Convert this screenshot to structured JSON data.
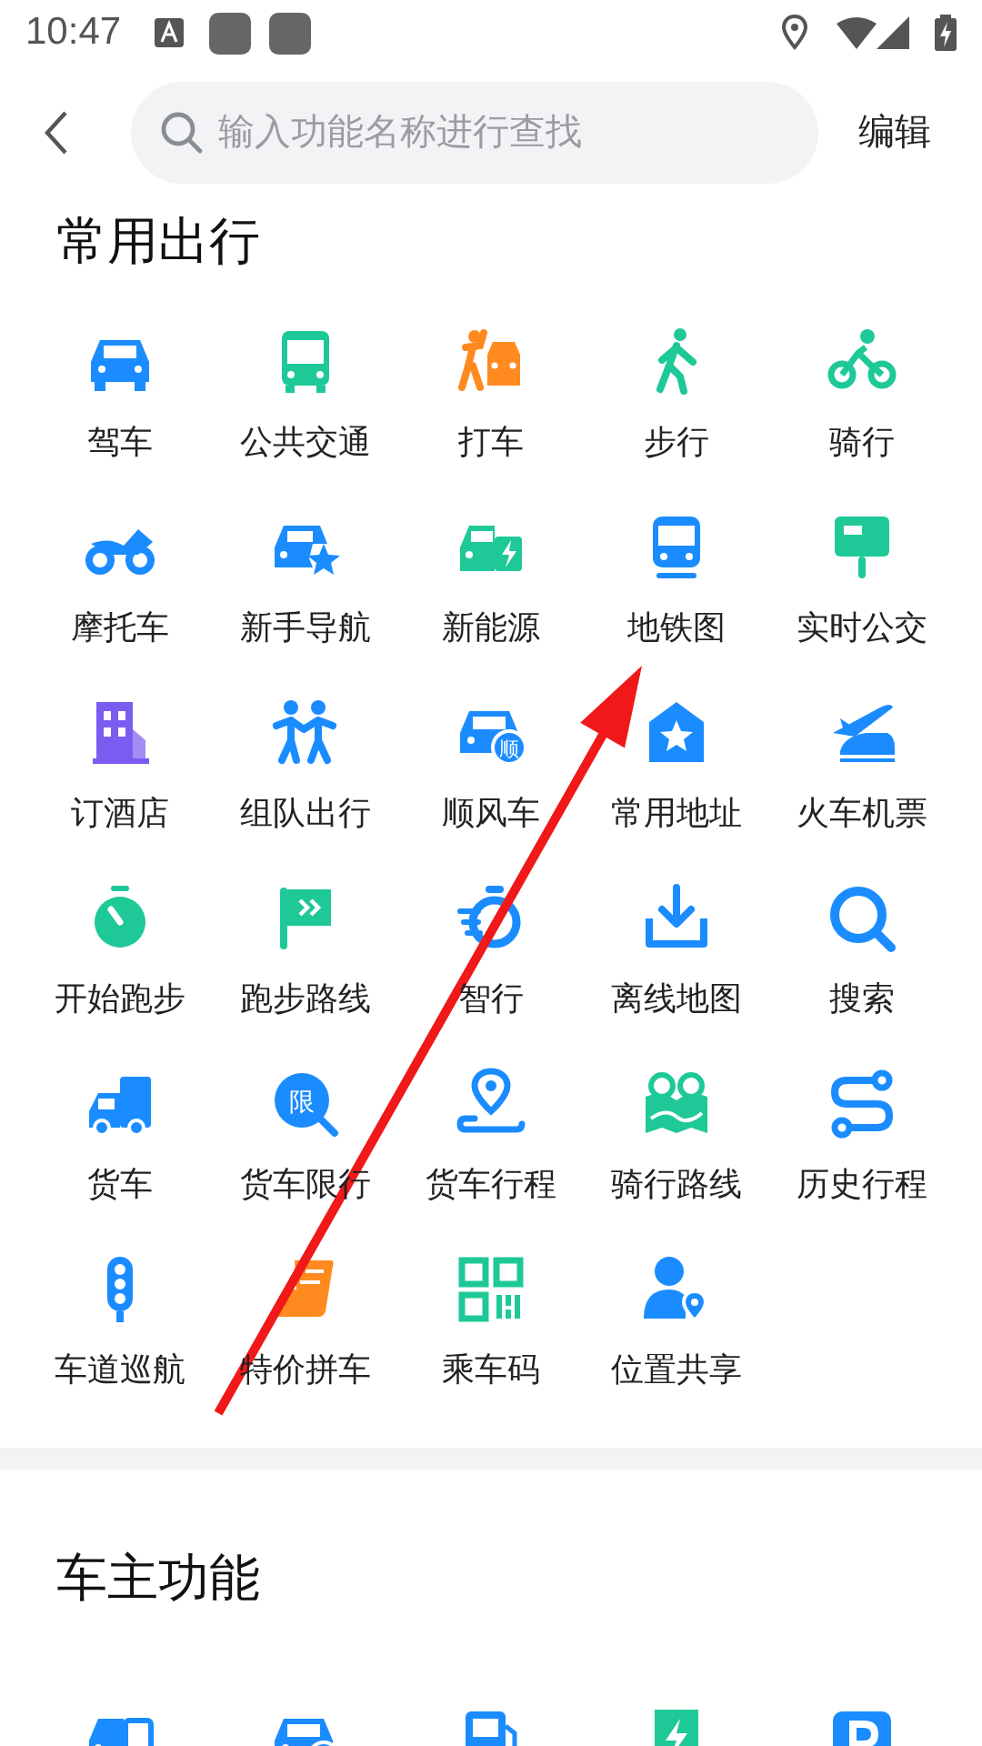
{
  "status_bar": {
    "time": "10:47"
  },
  "header": {
    "search": {
      "placeholder": "输入功能名称进行查找"
    },
    "edit": "编辑"
  },
  "sections": [
    {
      "title": "常用出行",
      "items": [
        {
          "label": "驾车",
          "kind": "car",
          "color": "#1a8cff"
        },
        {
          "label": "公共交通",
          "kind": "bus",
          "color": "#1ec997"
        },
        {
          "label": "打车",
          "kind": "hail",
          "color": "#ff8a1f"
        },
        {
          "label": "步行",
          "kind": "walk",
          "color": "#1ec997"
        },
        {
          "label": "骑行",
          "kind": "bike",
          "color": "#1ec997"
        },
        {
          "label": "摩托车",
          "kind": "moto",
          "color": "#1a8cff"
        },
        {
          "label": "新手导航",
          "kind": "carstar",
          "color": "#1a8cff"
        },
        {
          "label": "新能源",
          "kind": "ev",
          "color": "#1ec997"
        },
        {
          "label": "地铁图",
          "kind": "subway",
          "color": "#1a8cff"
        },
        {
          "label": "实时公交",
          "kind": "stop",
          "color": "#1ec997"
        },
        {
          "label": "订酒店",
          "kind": "hotel",
          "color": "#7b5cf0"
        },
        {
          "label": "组队出行",
          "kind": "team",
          "color": "#1a8cff"
        },
        {
          "label": "顺风车",
          "kind": "carbadge",
          "color": "#1a8cff",
          "icon_text": "顺"
        },
        {
          "label": "常用地址",
          "kind": "home",
          "color": "#1a8cff"
        },
        {
          "label": "火车机票",
          "kind": "plane",
          "color": "#1a8cff"
        },
        {
          "label": "开始跑步",
          "kind": "watch",
          "color": "#1ec997"
        },
        {
          "label": "跑步路线",
          "kind": "flag",
          "color": "#1ec997"
        },
        {
          "label": "智行",
          "kind": "speed",
          "color": "#1a8cff"
        },
        {
          "label": "离线地图",
          "kind": "download",
          "color": "#1a8cff"
        },
        {
          "label": "搜索",
          "kind": "search",
          "color": "#1a8cff"
        },
        {
          "label": "货车",
          "kind": "truck",
          "color": "#1a8cff"
        },
        {
          "label": "货车限行",
          "kind": "limit",
          "color": "#1a8cff",
          "icon_text": "限"
        },
        {
          "label": "货车行程",
          "kind": "pinroute",
          "color": "#1a8cff"
        },
        {
          "label": "骑行路线",
          "kind": "map",
          "color": "#1ec997"
        },
        {
          "label": "历史行程",
          "kind": "route",
          "color": "#1a8cff"
        },
        {
          "label": "车道巡航",
          "kind": "light",
          "color": "#1a8cff"
        },
        {
          "label": "特价拼车",
          "kind": "seat",
          "color": "#ff8a1f"
        },
        {
          "label": "乘车码",
          "kind": "qr",
          "color": "#1ec997"
        },
        {
          "label": "位置共享",
          "kind": "share",
          "color": "#1a8cff"
        }
      ]
    },
    {
      "title": "车主功能",
      "items": [
        {
          "kind": "carphone",
          "color": "#1a8cff"
        },
        {
          "kind": "carcheck",
          "color": "#1a8cff"
        },
        {
          "kind": "fuel",
          "color": "#1a8cff"
        },
        {
          "kind": "charger",
          "color": "#1ec997"
        },
        {
          "kind": "parking",
          "color": "#1a8cff"
        }
      ]
    }
  ]
}
